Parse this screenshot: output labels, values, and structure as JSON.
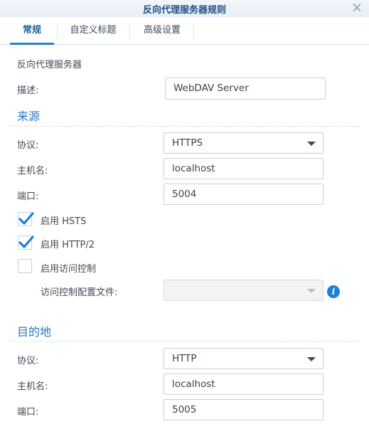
{
  "dialog": {
    "title": "反向代理服务器规则",
    "close_glyph": "×"
  },
  "tabs": [
    {
      "label": "常规",
      "active": true
    },
    {
      "label": "自定义标题",
      "active": false
    },
    {
      "label": "高级设置",
      "active": false
    }
  ],
  "general": {
    "heading": "反向代理服务器",
    "description_label": "描述:",
    "description_value": "WebDAV Server"
  },
  "source": {
    "heading": "来源",
    "protocol_label": "协议:",
    "protocol_value": "HTTPS",
    "hostname_label": "主机名:",
    "hostname_value": "localhost",
    "port_label": "端口:",
    "port_value": "5004",
    "hsts_label": "启用 HSTS",
    "hsts_checked": true,
    "http2_label": "启用 HTTP/2",
    "http2_checked": true,
    "access_control_label": "启用访问控制",
    "access_control_checked": false,
    "profile_label": "访问控制配置文件:",
    "profile_value": "",
    "info_glyph": "i"
  },
  "destination": {
    "heading": "目的地",
    "protocol_label": "协议:",
    "protocol_value": "HTTP",
    "hostname_label": "主机名:",
    "hostname_value": "localhost",
    "port_label": "端口:",
    "port_value": "5005"
  },
  "colors": {
    "accent": "#2a76c6",
    "title": "#1f4f80",
    "check": "#1e7fd6",
    "info": "#1e80d8"
  }
}
